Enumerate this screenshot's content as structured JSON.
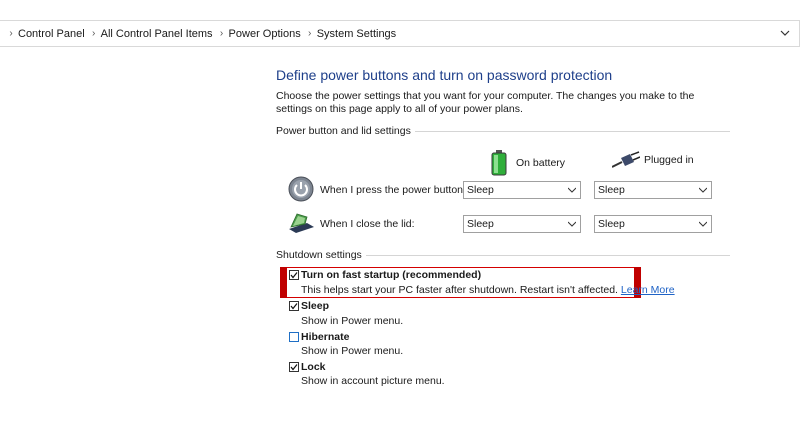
{
  "breadcrumb": [
    "Control Panel",
    "All Control Panel Items",
    "Power Options",
    "System Settings"
  ],
  "page": {
    "title": "Define power buttons and turn on password protection",
    "description": "Choose the power settings that you want for your computer. The changes you make to the settings on this page apply to all of your power plans."
  },
  "power_group": {
    "label": "Power button and lid settings",
    "col_battery": "On battery",
    "col_plugged": "Plugged in",
    "rows": [
      {
        "label": "When I press the power button:",
        "battery": "Sleep",
        "plugged": "Sleep"
      },
      {
        "label": "When I close the lid:",
        "battery": "Sleep",
        "plugged": "Sleep"
      }
    ]
  },
  "shutdown_group": {
    "label": "Shutdown settings",
    "options": [
      {
        "title": "Turn on fast startup (recommended)",
        "desc": "This helps start your PC faster after shutdown. Restart isn't affected.",
        "link": "Learn More",
        "checked": true,
        "highlighted": true
      },
      {
        "title": "Sleep",
        "desc": "Show in Power menu.",
        "checked": true
      },
      {
        "title": "Hibernate",
        "desc": "Show in Power menu.",
        "checked": false
      },
      {
        "title": "Lock",
        "desc": "Show in account picture menu.",
        "checked": true
      }
    ]
  },
  "colors": {
    "title": "#1e3f8a",
    "link": "#1f63c6",
    "highlight": "#c00000"
  }
}
